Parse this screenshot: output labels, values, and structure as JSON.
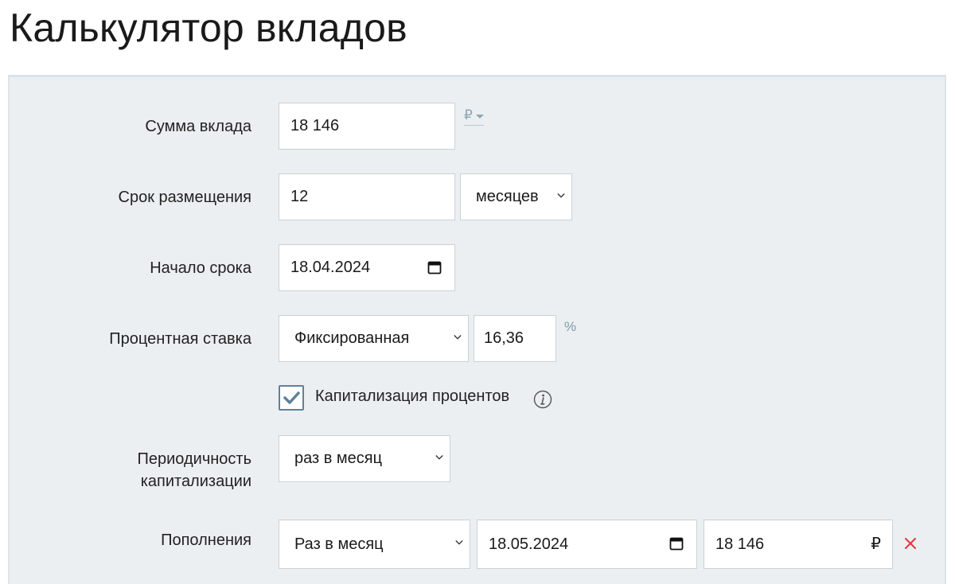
{
  "page": {
    "title": "Калькулятор вкладов"
  },
  "form": {
    "amount": {
      "label": "Сумма вклада",
      "value": "18 146",
      "currency": "₽"
    },
    "term": {
      "label": "Срок размещения",
      "value": "12",
      "unit": "месяцев"
    },
    "start": {
      "label": "Начало срока",
      "value": "18.04.2024"
    },
    "rate": {
      "label": "Процентная ставка",
      "type": "Фиксированная",
      "value": "16,36",
      "unit": "%"
    },
    "capitalization": {
      "label": "Капитализация процентов",
      "checked": true
    },
    "frequency": {
      "label_line1": "Периодичность",
      "label_line2": "капитализации",
      "value": "раз в месяц"
    },
    "deposits": {
      "label": "Пополнения",
      "frequency": "Раз в месяц",
      "date": "18.05.2024",
      "amount": "18 146",
      "currency": "₽"
    }
  },
  "icons": {
    "calendar": "calendar-icon",
    "chevron": "chevron-down-icon",
    "check": "check-icon",
    "info": "info-icon",
    "remove": "close-icon"
  },
  "colors": {
    "panel": "#ebeff1",
    "accent": "#5e8299",
    "remove": "#e0343b",
    "muted": "#8ea6b6"
  }
}
